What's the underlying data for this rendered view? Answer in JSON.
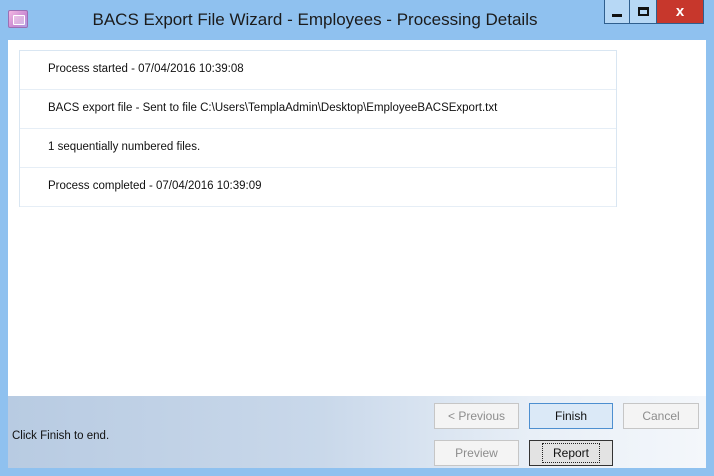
{
  "window": {
    "title": "BACS Export File Wizard - Employees - Processing Details",
    "close_glyph": "x"
  },
  "log": {
    "lines": [
      "Process started - 07/04/2016 10:39:08",
      "BACS export file - Sent to file C:\\Users\\TemplaAdmin\\Desktop\\EmployeeBACSExport.txt",
      "1 sequentially numbered files.",
      "Process completed - 07/04/2016 10:39:09"
    ]
  },
  "footer": {
    "status": "Click Finish to end.",
    "previous_label": "< Previous",
    "finish_label": "Finish",
    "cancel_label": "Cancel",
    "preview_label": "Preview",
    "report_label": "Report"
  },
  "colors": {
    "title_bar": "#8fc1ef",
    "close_button": "#c7372c",
    "primary_button_border": "#4d8fd0"
  }
}
